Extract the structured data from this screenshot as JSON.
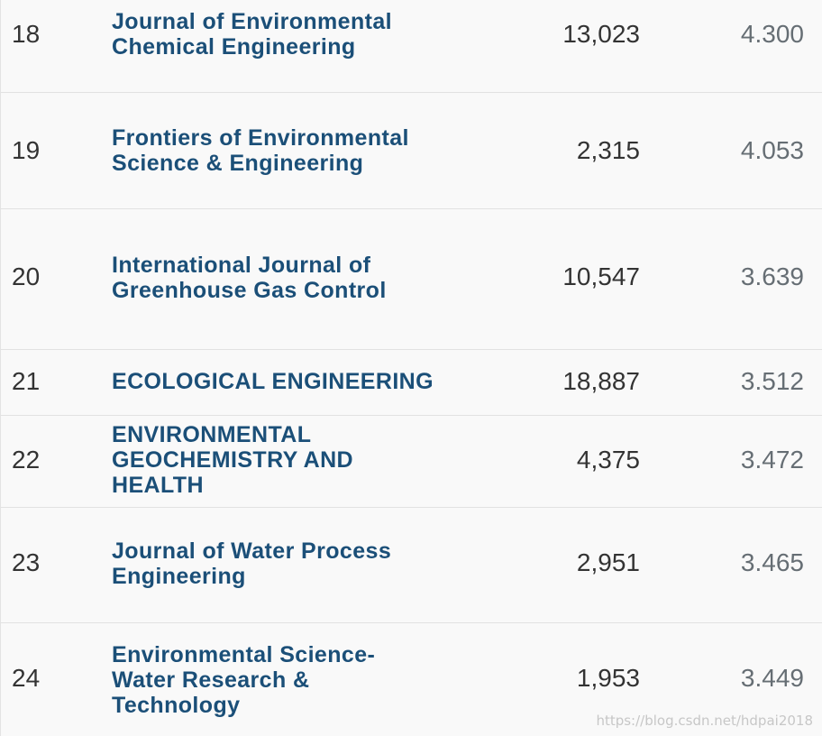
{
  "rows": [
    {
      "rank": "18",
      "title_lines": [
        "Journal of Environmental",
        "Chemical Engineering"
      ],
      "citations": "13,023",
      "impact": "4.300"
    },
    {
      "rank": "19",
      "title_lines": [
        "Frontiers of Environmental",
        "Science & Engineering"
      ],
      "citations": "2,315",
      "impact": "4.053"
    },
    {
      "rank": "20",
      "title_lines": [
        "International Journal of",
        "Greenhouse Gas Control"
      ],
      "citations": "10,547",
      "impact": "3.639"
    },
    {
      "rank": "21",
      "title_lines": [
        "ECOLOGICAL ENGINEERING"
      ],
      "citations": "18,887",
      "impact": "3.512"
    },
    {
      "rank": "22",
      "title_lines": [
        "ENVIRONMENTAL",
        "GEOCHEMISTRY AND",
        "HEALTH"
      ],
      "citations": "4,375",
      "impact": "3.472"
    },
    {
      "rank": "23",
      "title_lines": [
        "Journal of Water Process",
        "Engineering"
      ],
      "citations": "2,951",
      "impact": "3.465"
    },
    {
      "rank": "24",
      "title_lines": [
        "Environmental Science-",
        "Water Research &",
        "Technology"
      ],
      "citations": "1,953",
      "impact": "3.449"
    }
  ],
  "watermark": "https://blog.csdn.net/hdpai2018"
}
